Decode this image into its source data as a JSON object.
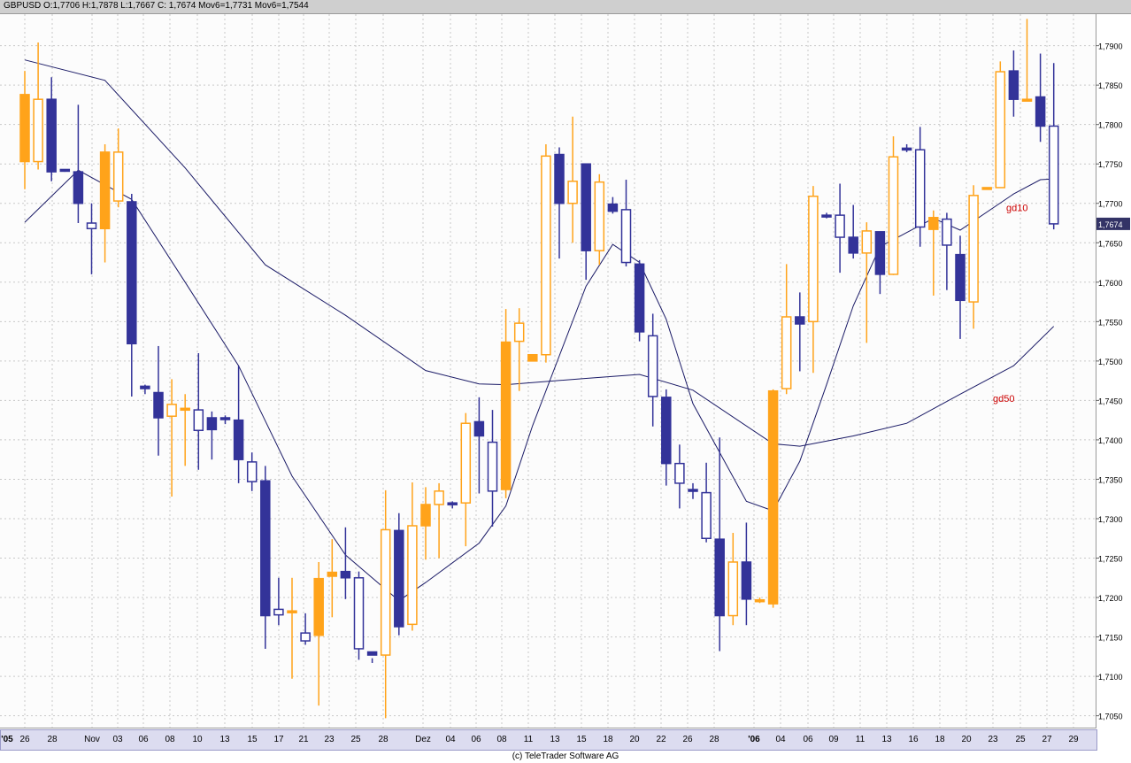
{
  "header": {
    "title_text": "GBPUSD O:1,7706 H:1,7878 L:1,7667 C: 1,7674 Mov6=1,7731 Mov6=1,7544"
  },
  "footer": {
    "copyright": "(c) TeleTrader Software AG"
  },
  "colors": {
    "up": "#ffa31a",
    "down": "#333399",
    "ma": "#1a1a66",
    "grid": "#c8c8c8",
    "price_tag_bg": "#333366",
    "ma_label": "#cc0000"
  },
  "chart_data": {
    "type": "candlestick",
    "symbol": "GBPUSD",
    "ylim": [
      1.7035,
      1.794
    ],
    "yticks": [
      "1,7050",
      "1,7100",
      "1,7150",
      "1,7200",
      "1,7250",
      "1,7300",
      "1,7350",
      "1,7400",
      "1,7450",
      "1,7500",
      "1,7550",
      "1,7600",
      "1,7650",
      "1,7700",
      "1,7750",
      "1,7800",
      "1,7850",
      "1,7900"
    ],
    "x_labels": [
      "'05",
      "26",
      "28",
      "Nov",
      "03",
      "06",
      "08",
      "10",
      "13",
      "15",
      "17",
      "21",
      "23",
      "25",
      "28",
      "Dez",
      "04",
      "06",
      "08",
      "11",
      "13",
      "15",
      "18",
      "20",
      "22",
      "26",
      "28",
      "'06",
      "04",
      "06",
      "09",
      "11",
      "13",
      "16",
      "18",
      "20",
      "23",
      "25",
      "27",
      "29"
    ],
    "last_price_label": "1,7674",
    "candles": [
      {
        "o": 1.7753,
        "h": 1.7868,
        "l": 1.7718,
        "c": 1.7838
      },
      {
        "o": 1.7753,
        "h": 1.7904,
        "l": 1.7743,
        "c": 1.7832
      },
      {
        "o": 1.7832,
        "h": 1.786,
        "l": 1.7728,
        "c": 1.774
      },
      {
        "o": 1.7743,
        "h": 1.7743,
        "l": 1.774,
        "c": 1.7741
      },
      {
        "o": 1.774,
        "h": 1.7825,
        "l": 1.7675,
        "c": 1.77
      },
      {
        "o": 1.7675,
        "h": 1.77,
        "l": 1.761,
        "c": 1.7668
      },
      {
        "o": 1.7668,
        "h": 1.7775,
        "l": 1.7625,
        "c": 1.7765
      },
      {
        "o": 1.7703,
        "h": 1.7795,
        "l": 1.7695,
        "c": 1.7765
      },
      {
        "o": 1.7702,
        "h": 1.7712,
        "l": 1.7455,
        "c": 1.7522
      },
      {
        "o": 1.7468,
        "h": 1.747,
        "l": 1.7458,
        "c": 1.7465
      },
      {
        "o": 1.746,
        "h": 1.7519,
        "l": 1.738,
        "c": 1.7428
      },
      {
        "o": 1.743,
        "h": 1.7477,
        "l": 1.7328,
        "c": 1.7445
      },
      {
        "o": 1.744,
        "h": 1.7458,
        "l": 1.7367,
        "c": 1.744
      },
      {
        "o": 1.7438,
        "h": 1.751,
        "l": 1.7362,
        "c": 1.7412
      },
      {
        "o": 1.7428,
        "h": 1.7436,
        "l": 1.7375,
        "c": 1.7413
      },
      {
        "o": 1.7428,
        "h": 1.7431,
        "l": 1.742,
        "c": 1.7426
      },
      {
        "o": 1.7425,
        "h": 1.7494,
        "l": 1.7345,
        "c": 1.7375
      },
      {
        "o": 1.7372,
        "h": 1.7384,
        "l": 1.7335,
        "c": 1.7347
      },
      {
        "o": 1.7348,
        "h": 1.7367,
        "l": 1.7135,
        "c": 1.7177
      },
      {
        "o": 1.7185,
        "h": 1.7225,
        "l": 1.7165,
        "c": 1.7178
      },
      {
        "o": 1.7183,
        "h": 1.7225,
        "l": 1.7097,
        "c": 1.7183
      },
      {
        "o": 1.7155,
        "h": 1.718,
        "l": 1.714,
        "c": 1.7145
      },
      {
        "o": 1.7152,
        "h": 1.7245,
        "l": 1.7063,
        "c": 1.7224
      },
      {
        "o": 1.7227,
        "h": 1.7274,
        "l": 1.7175,
        "c": 1.7232
      },
      {
        "o": 1.7233,
        "h": 1.7289,
        "l": 1.7198,
        "c": 1.7225
      },
      {
        "o": 1.7225,
        "h": 1.7233,
        "l": 1.7121,
        "c": 1.7135
      },
      {
        "o": 1.7131,
        "h": 1.7123,
        "l": 1.7117,
        "c": 1.7127
      },
      {
        "o": 1.7127,
        "h": 1.7336,
        "l": 1.7047,
        "c": 1.7286
      },
      {
        "o": 1.7285,
        "h": 1.7307,
        "l": 1.7152,
        "c": 1.7163
      },
      {
        "o": 1.7166,
        "h": 1.7346,
        "l": 1.7158,
        "c": 1.7291
      },
      {
        "o": 1.7291,
        "h": 1.734,
        "l": 1.7248,
        "c": 1.7318
      },
      {
        "o": 1.7318,
        "h": 1.7345,
        "l": 1.725,
        "c": 1.7335
      },
      {
        "o": 1.732,
        "h": 1.7322,
        "l": 1.7313,
        "c": 1.7318
      },
      {
        "o": 1.732,
        "h": 1.7434,
        "l": 1.7265,
        "c": 1.7421
      },
      {
        "o": 1.7423,
        "h": 1.7454,
        "l": 1.7332,
        "c": 1.7405
      },
      {
        "o": 1.7397,
        "h": 1.7438,
        "l": 1.729,
        "c": 1.7335
      },
      {
        "o": 1.7337,
        "h": 1.7566,
        "l": 1.7326,
        "c": 1.7524
      },
      {
        "o": 1.7525,
        "h": 1.7567,
        "l": 1.7462,
        "c": 1.7548
      },
      {
        "o": 1.75,
        "h": 1.7508,
        "l": 1.75,
        "c": 1.7508
      },
      {
        "o": 1.7508,
        "h": 1.7775,
        "l": 1.7498,
        "c": 1.776
      },
      {
        "o": 1.7762,
        "h": 1.7771,
        "l": 1.763,
        "c": 1.77
      },
      {
        "o": 1.77,
        "h": 1.781,
        "l": 1.765,
        "c": 1.7728
      },
      {
        "o": 1.775,
        "h": 1.7748,
        "l": 1.7603,
        "c": 1.764
      },
      {
        "o": 1.764,
        "h": 1.7737,
        "l": 1.7622,
        "c": 1.7727
      },
      {
        "o": 1.7699,
        "h": 1.7708,
        "l": 1.7687,
        "c": 1.769
      },
      {
        "o": 1.7692,
        "h": 1.773,
        "l": 1.762,
        "c": 1.7625
      },
      {
        "o": 1.7623,
        "h": 1.7628,
        "l": 1.7525,
        "c": 1.7537
      },
      {
        "o": 1.7532,
        "h": 1.756,
        "l": 1.7417,
        "c": 1.7455
      },
      {
        "o": 1.7454,
        "h": 1.7464,
        "l": 1.7342,
        "c": 1.737
      },
      {
        "o": 1.737,
        "h": 1.7394,
        "l": 1.7313,
        "c": 1.7345
      },
      {
        "o": 1.7337,
        "h": 1.7345,
        "l": 1.7325,
        "c": 1.7335
      },
      {
        "o": 1.7333,
        "h": 1.7371,
        "l": 1.727,
        "c": 1.7275
      },
      {
        "o": 1.7274,
        "h": 1.7403,
        "l": 1.7132,
        "c": 1.7177
      },
      {
        "o": 1.7177,
        "h": 1.7282,
        "l": 1.7165,
        "c": 1.7245
      },
      {
        "o": 1.7245,
        "h": 1.7295,
        "l": 1.7165,
        "c": 1.7198
      },
      {
        "o": 1.7197,
        "h": 1.72,
        "l": 1.7193,
        "c": 1.7197
      },
      {
        "o": 1.7192,
        "h": 1.7464,
        "l": 1.7187,
        "c": 1.7462
      },
      {
        "o": 1.7465,
        "h": 1.7623,
        "l": 1.7458,
        "c": 1.7556
      },
      {
        "o": 1.7556,
        "h": 1.7587,
        "l": 1.7487,
        "c": 1.7547
      },
      {
        "o": 1.755,
        "h": 1.7722,
        "l": 1.7485,
        "c": 1.7709
      },
      {
        "o": 1.7685,
        "h": 1.7688,
        "l": 1.7681,
        "c": 1.7684
      },
      {
        "o": 1.7685,
        "h": 1.7725,
        "l": 1.7612,
        "c": 1.7657
      },
      {
        "o": 1.7657,
        "h": 1.7698,
        "l": 1.763,
        "c": 1.7637
      },
      {
        "o": 1.7637,
        "h": 1.7676,
        "l": 1.7523,
        "c": 1.7665
      },
      {
        "o": 1.7664,
        "h": 1.7663,
        "l": 1.7585,
        "c": 1.761
      },
      {
        "o": 1.761,
        "h": 1.7785,
        "l": 1.7609,
        "c": 1.7759
      },
      {
        "o": 1.777,
        "h": 1.7775,
        "l": 1.7765,
        "c": 1.7768
      },
      {
        "o": 1.7768,
        "h": 1.7797,
        "l": 1.7645,
        "c": 1.767
      },
      {
        "o": 1.7667,
        "h": 1.7691,
        "l": 1.7583,
        "c": 1.7682
      },
      {
        "o": 1.768,
        "h": 1.7688,
        "l": 1.759,
        "c": 1.7647
      },
      {
        "o": 1.7635,
        "h": 1.7659,
        "l": 1.7528,
        "c": 1.7577
      },
      {
        "o": 1.7575,
        "h": 1.7723,
        "l": 1.7541,
        "c": 1.771
      },
      {
        "o": 1.772,
        "h": 1.772,
        "l": 1.772,
        "c": 1.772
      },
      {
        "o": 1.772,
        "h": 1.788,
        "l": 1.772,
        "c": 1.7867
      },
      {
        "o": 1.7868,
        "h": 1.7894,
        "l": 1.781,
        "c": 1.7832
      },
      {
        "o": 1.7832,
        "h": 1.7934,
        "l": 1.7832,
        "c": 1.7832
      },
      {
        "o": 1.7835,
        "h": 1.789,
        "l": 1.7778,
        "c": 1.7798
      },
      {
        "o": 1.7798,
        "h": 1.7878,
        "l": 1.7667,
        "c": 1.7674
      }
    ],
    "series": [
      {
        "name": "gd10",
        "points": [
          [
            0,
            1.7676
          ],
          [
            4,
            1.7742
          ],
          [
            8,
            1.7705
          ],
          [
            12,
            1.76
          ],
          [
            16,
            1.7494
          ],
          [
            20,
            1.7354
          ],
          [
            24,
            1.7254
          ],
          [
            28,
            1.7196
          ],
          [
            30,
            1.7219
          ],
          [
            34,
            1.7269
          ],
          [
            36,
            1.7316
          ],
          [
            38,
            1.7418
          ],
          [
            42,
            1.7595
          ],
          [
            44,
            1.7648
          ],
          [
            46,
            1.7625
          ],
          [
            48,
            1.7553
          ],
          [
            50,
            1.7446
          ],
          [
            54,
            1.7322
          ],
          [
            56,
            1.731
          ],
          [
            58,
            1.7373
          ],
          [
            60,
            1.747
          ],
          [
            62,
            1.757
          ],
          [
            64,
            1.7645
          ],
          [
            66,
            1.7663
          ],
          [
            68,
            1.7681
          ],
          [
            70,
            1.7666
          ],
          [
            74,
            1.7712
          ],
          [
            76,
            1.773
          ],
          [
            77,
            1.7731
          ]
        ]
      },
      {
        "name": "gd50",
        "points": [
          [
            0,
            1.7882
          ],
          [
            6,
            1.7856
          ],
          [
            12,
            1.7745
          ],
          [
            18,
            1.7622
          ],
          [
            24,
            1.7558
          ],
          [
            30,
            1.7488
          ],
          [
            34,
            1.7471
          ],
          [
            36,
            1.747
          ],
          [
            42,
            1.7478
          ],
          [
            46,
            1.7483
          ],
          [
            50,
            1.7463
          ],
          [
            56,
            1.7395
          ],
          [
            58,
            1.7392
          ],
          [
            62,
            1.7405
          ],
          [
            66,
            1.7421
          ],
          [
            70,
            1.7458
          ],
          [
            74,
            1.7494
          ],
          [
            77,
            1.7544
          ]
        ]
      }
    ]
  }
}
